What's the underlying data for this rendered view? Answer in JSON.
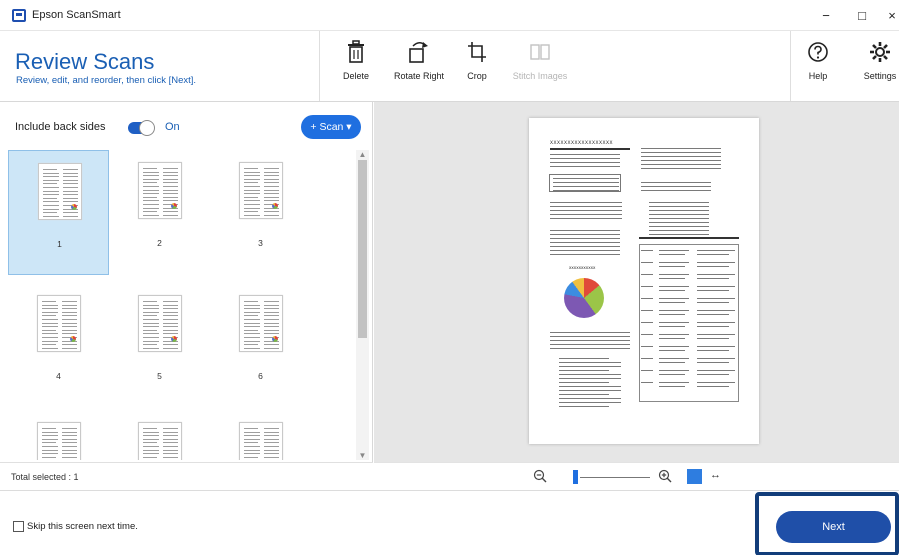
{
  "window": {
    "app_title": "Epson ScanSmart",
    "minimize": "−",
    "maximize": "□",
    "close": "×"
  },
  "header": {
    "title": "Review Scans",
    "subtitle": "Review, edit, and reorder, then click [Next]."
  },
  "toolbar": {
    "delete_label": "Delete",
    "rotate_label": "Rotate Right",
    "crop_label": "Crop",
    "stitch_label": "Stitch Images",
    "help_label": "Help",
    "settings_label": "Settings"
  },
  "left_panel": {
    "include_back_label": "Include back sides",
    "toggle_state": "On",
    "scan_button": "+ Scan ▾",
    "total_selected": "Total selected : 1",
    "thumbnails": [
      {
        "label": "1",
        "selected": true
      },
      {
        "label": "2",
        "selected": false
      },
      {
        "label": "3",
        "selected": false
      },
      {
        "label": "4",
        "selected": false
      },
      {
        "label": "5",
        "selected": false
      },
      {
        "label": "6",
        "selected": false
      },
      {
        "label": "",
        "selected": false
      },
      {
        "label": "",
        "selected": false
      },
      {
        "label": "",
        "selected": false
      }
    ]
  },
  "preview": {
    "doc_heading": "XXXXXXXXXXXXXXXXXX",
    "pie_title": "XXXXXXXXXXX"
  },
  "zoom": {
    "expand_glyph": "↔"
  },
  "footer": {
    "skip_label": "Skip this screen next time.",
    "next_button": "Next"
  },
  "colors": {
    "accent": "#1f6fe0",
    "title_blue": "#1a5fb4",
    "selected_bg": "#cde6f7",
    "next_bg": "#1f4fa8",
    "highlight_border": "#123d7a"
  }
}
